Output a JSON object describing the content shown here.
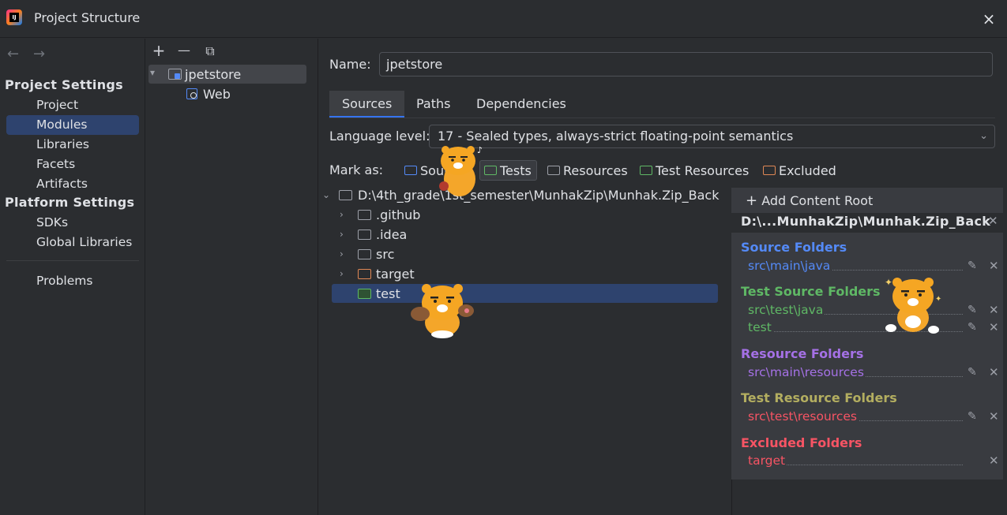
{
  "window": {
    "title": "Project Structure",
    "close_icon": "×"
  },
  "nav": {
    "back": "←",
    "forward": "→"
  },
  "sidebar": {
    "project_settings_title": "Project Settings",
    "items": [
      {
        "label": "Project"
      },
      {
        "label": "Modules"
      },
      {
        "label": "Libraries"
      },
      {
        "label": "Facets"
      },
      {
        "label": "Artifacts"
      }
    ],
    "platform_settings_title": "Platform Settings",
    "platform_items": [
      {
        "label": "SDKs"
      },
      {
        "label": "Global Libraries"
      }
    ],
    "problems_label": "Problems"
  },
  "modules": {
    "toolbar": {
      "add": "+",
      "remove": "—",
      "copy": "⧉"
    },
    "tree": [
      {
        "label": "jpetstore"
      },
      {
        "label": "Web"
      }
    ]
  },
  "main": {
    "name_label": "Name:",
    "name_value": "jpetstore",
    "tabs": [
      {
        "label": "Sources"
      },
      {
        "label": "Paths"
      },
      {
        "label": "Dependencies"
      }
    ],
    "language_label": "Language level:",
    "language_value": "17 - Sealed types, always-strict floating-point semantics",
    "mark_as_label": "Mark as:",
    "mark_buttons": [
      {
        "label": "Sources",
        "color": "#548af7"
      },
      {
        "label": "Tests",
        "color": "#5fb865"
      },
      {
        "label": "Resources",
        "color": "#9da0a8"
      },
      {
        "label": "Test Resources",
        "color": "#5fb865"
      },
      {
        "label": "Excluded",
        "color": "#e08855"
      }
    ],
    "folder_tree": {
      "root": "D:\\4th_grade\\1st_semester\\MunhakZip\\Munhak.Zip_Back",
      "children": [
        {
          "label": ".github"
        },
        {
          "label": ".idea"
        },
        {
          "label": "src"
        },
        {
          "label": "target"
        },
        {
          "label": "test"
        }
      ]
    }
  },
  "content_roots": {
    "add_label": "Add Content Root",
    "root_path": "D:\\...MunhakZip\\Munhak.Zip_Back",
    "groups": [
      {
        "title": "Source Folders",
        "color": "#548af7",
        "entries": [
          "src\\main\\java"
        ]
      },
      {
        "title": "Test Source Folders",
        "color": "#5fb865",
        "entries": [
          "src\\test\\java",
          "test"
        ]
      },
      {
        "title": "Resource Folders",
        "color": "#a571e6",
        "entries": [
          "src\\main\\resources"
        ]
      },
      {
        "title": "Test Resource Folders",
        "color": "#b3ae60",
        "entries": [
          "src\\test\\resources"
        ]
      },
      {
        "title": "Excluded Folders",
        "color": "#f75464",
        "entries": [
          "target"
        ]
      }
    ]
  }
}
